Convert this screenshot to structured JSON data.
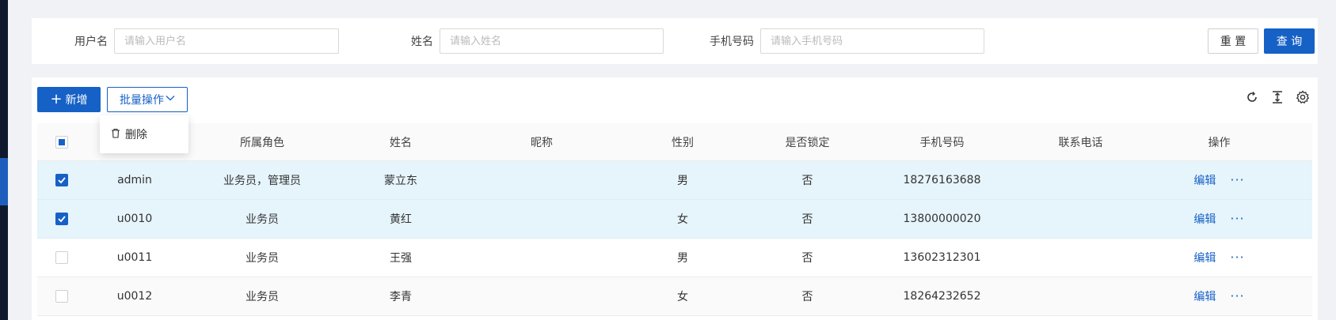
{
  "search": {
    "username_label": "用户名",
    "username_placeholder": "请输入用户名",
    "name_label": "姓名",
    "name_placeholder": "请输入姓名",
    "phone_label": "手机号码",
    "phone_placeholder": "请输入手机号码",
    "reset_label": "重 置",
    "query_label": "查 询"
  },
  "toolbar": {
    "add_label": "新增",
    "batch_label": "批量操作",
    "icons": [
      "refresh-icon",
      "column-height-icon",
      "settings-icon"
    ]
  },
  "dropdown": {
    "delete_label": "删除"
  },
  "table": {
    "columns": [
      "所属角色",
      "姓名",
      "昵称",
      "性别",
      "是否锁定",
      "手机号码",
      "联系电话",
      "操作"
    ],
    "rows": [
      {
        "username": "admin",
        "role": "业务员，管理员",
        "name": "蒙立东",
        "nickname": "",
        "gender": "男",
        "locked": "否",
        "phone": "18276163688",
        "tel": "",
        "checked": true
      },
      {
        "username": "u0010",
        "role": "业务员",
        "name": "黄红",
        "nickname": "",
        "gender": "女",
        "locked": "否",
        "phone": "13800000020",
        "tel": "",
        "checked": true
      },
      {
        "username": "u0011",
        "role": "业务员",
        "name": "王强",
        "nickname": "",
        "gender": "男",
        "locked": "否",
        "phone": "13602312301",
        "tel": "",
        "checked": false
      },
      {
        "username": "u0012",
        "role": "业务员",
        "name": "李青",
        "nickname": "",
        "gender": "女",
        "locked": "否",
        "phone": "18264232652",
        "tel": "",
        "checked": false
      }
    ],
    "edit_label": "编辑",
    "more_label": "···"
  },
  "colors": {
    "primary": "#1661c6",
    "selected_row": "#e6f4fb",
    "sidebar": "#0f1a2e"
  }
}
